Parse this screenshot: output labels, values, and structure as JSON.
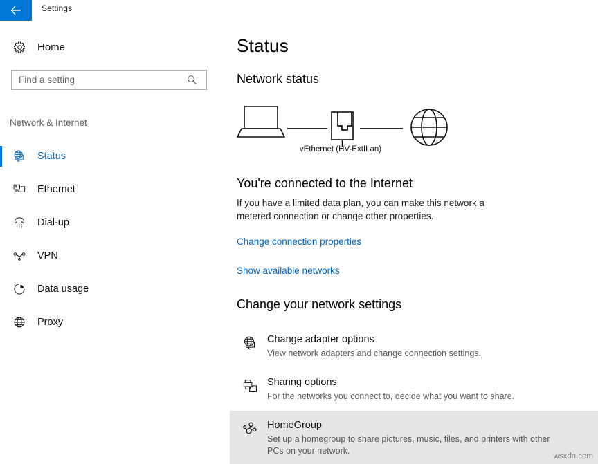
{
  "titlebar": {
    "back_icon": "back-arrow-icon",
    "title": "Settings",
    "accent_color": "#0078d7"
  },
  "sidebar": {
    "home": {
      "label": "Home",
      "icon": "gear-icon"
    },
    "search": {
      "value": "",
      "placeholder": "Find a setting",
      "icon": "search-icon"
    },
    "group_header": "Network & Internet",
    "items": [
      {
        "label": "Status",
        "icon": "globe-monitor-icon",
        "selected": true
      },
      {
        "label": "Ethernet",
        "icon": "ethernet-icon",
        "selected": false
      },
      {
        "label": "Dial-up",
        "icon": "dialup-phone-icon",
        "selected": false
      },
      {
        "label": "VPN",
        "icon": "vpn-key-icon",
        "selected": false
      },
      {
        "label": "Data usage",
        "icon": "pie-chart-icon",
        "selected": false
      },
      {
        "label": "Proxy",
        "icon": "globe-icon",
        "selected": false
      }
    ],
    "selected_accent": "#0078d7",
    "selected_text_color": "#0f6cbd"
  },
  "main": {
    "page_title": "Status",
    "network_status_heading": "Network status",
    "diagram": {
      "device_icon": "laptop-icon",
      "adapter_icon": "network-adapter-icon",
      "internet_icon": "globe-icon",
      "adapter_label": "vEthernet (HV-ExtILan)"
    },
    "connection_title": "You're connected to the Internet",
    "connection_description": "If you have a limited data plan, you can make this network a metered connection or change other properties.",
    "links": [
      {
        "label": "Change connection properties"
      },
      {
        "label": "Show available networks"
      }
    ],
    "link_color": "#0067c0",
    "settings_heading": "Change your network settings",
    "options": [
      {
        "title": "Change adapter options",
        "subtitle": "View network adapters and change connection settings.",
        "icon": "globe-monitor-icon",
        "highlighted": false
      },
      {
        "title": "Sharing options",
        "subtitle": "For the networks you connect to, decide what you want to share.",
        "icon": "printer-folder-icon",
        "highlighted": false
      },
      {
        "title": "HomeGroup",
        "subtitle": "Set up a homegroup to share pictures, music, files, and printers with other PCs on your network.",
        "icon": "homegroup-people-icon",
        "highlighted": true
      }
    ],
    "highlight_color": "#e6e6e6"
  },
  "watermark": "wsxdn.com"
}
